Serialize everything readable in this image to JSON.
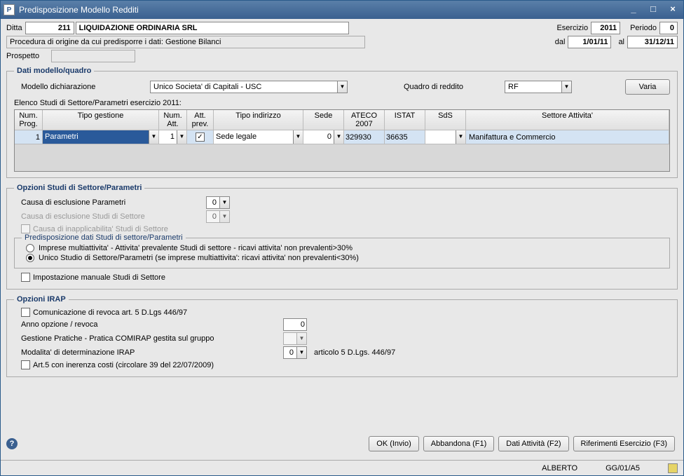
{
  "window": {
    "title": "Predisposizione Modello Redditi"
  },
  "header": {
    "ditta_label": "Ditta",
    "ditta_num": "211",
    "ditta_name": "LIQUIDAZIONE ORDINARIA SRL",
    "esercizio_label": "Esercizio",
    "esercizio_val": "2011",
    "periodo_label": "Periodo",
    "periodo_val": "0",
    "proc_label": "Procedura di origine da cui predisporre i dati: Gestione Bilanci",
    "dal_label": "dal",
    "dal_val": "1/01/11",
    "al_label": "al",
    "al_val": "31/12/11",
    "prospetto_label": "Prospetto",
    "prospetto_val": ""
  },
  "dati_modello": {
    "legend": "Dati modello/quadro",
    "modello_label": "Modello dichiarazione",
    "modello_val": "Unico Societa' di Capitali - USC",
    "quadro_label": "Quadro di reddito",
    "quadro_val": "RF",
    "varia_btn": "Varia",
    "elenco_label": "Elenco Studi di Settore/Parametri esercizio 2011:",
    "cols": {
      "numprog": "Num. Prog.",
      "tipogest": "Tipo gestione",
      "numatt": "Num. Att.",
      "attprev": "Att. prev.",
      "tipoind": "Tipo indirizzo",
      "sede": "Sede",
      "ateco": "ATECO 2007",
      "istat": "ISTAT",
      "sds": "SdS",
      "settore": "Settore Attivita'"
    },
    "row": {
      "numprog": "1",
      "tipogest": "Parametri",
      "numatt": "1",
      "attprev_checked": "✓",
      "tipoind": "Sede legale",
      "sede": "0",
      "ateco": "329930",
      "istat": "36635",
      "sds": "",
      "settore": "Manifattura e Commercio"
    }
  },
  "opzioni_studi": {
    "legend": "Opzioni Studi di Settore/Parametri",
    "causa_param_label": "Causa di esclusione Parametri",
    "causa_param_val": "0",
    "causa_sds_label": "Causa di esclusione Studi di Settore",
    "causa_sds_val": "0",
    "causa_inapp_label": "Causa di inapplicabilita' Studi di Settore",
    "predisp_legend": "Predisposizione dati Studi di settore/Parametri",
    "radio1": "Imprese multiattivita' - Attivita' prevalente Studi di settore - ricavi attivita' non prevalenti>30%",
    "radio2": "Unico Studio di Settore/Parametri (se imprese multiattivita': ricavi attivita' non prevalenti<30%)",
    "imp_manuale": "Impostazione manuale Studi di Settore"
  },
  "opzioni_irap": {
    "legend": "Opzioni IRAP",
    "com_revoca": "Comunicazione di revoca art. 5 D.Lgs 446/97",
    "anno_label": "Anno opzione / revoca",
    "anno_val": "0",
    "gestione_label": "Gestione Pratiche - Pratica COMIRAP gestita sul gruppo",
    "gestione_val": "",
    "modalita_label": "Modalita' di determinazione IRAP",
    "modalita_val": "0",
    "modalita_desc": "articolo 5 D.Lgs. 446/97",
    "art5_label": "Art.5 con inerenza costi (circolare 39 del 22/07/2009)"
  },
  "footer": {
    "ok": "OK (Invio)",
    "abbandona": "Abbandona (F1)",
    "dati_att": "Dati Attività (F2)",
    "rif_es": "Riferimenti Esercizio (F3)"
  },
  "status": {
    "user": "ALBERTO",
    "code": "GG/01/A5"
  }
}
